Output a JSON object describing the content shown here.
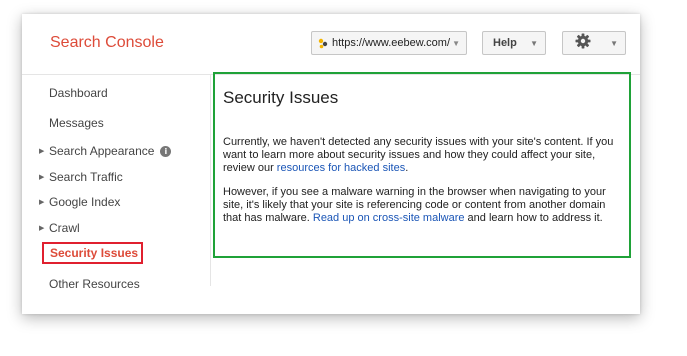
{
  "header": {
    "brand": "Search Console",
    "site_url": "https://www.eebew.com/",
    "help_label": "Help",
    "settings_icon": "gear-icon"
  },
  "sidebar": {
    "items": [
      {
        "label": "Dashboard",
        "expandable": false
      },
      {
        "label": "Messages",
        "expandable": false
      },
      {
        "label": "Search Appearance",
        "expandable": true,
        "info_icon": true
      },
      {
        "label": "Search Traffic",
        "expandable": true
      },
      {
        "label": "Google Index",
        "expandable": true
      },
      {
        "label": "Crawl",
        "expandable": true
      },
      {
        "label": "Security Issues",
        "active": true
      },
      {
        "label": "Other Resources",
        "expandable": false
      }
    ]
  },
  "main": {
    "title": "Security Issues",
    "p1_text_before": "Currently, we haven't detected any security issues with your site's content. If you want to learn more about security issues and how they could affect your site, review our ",
    "p1_link": "resources for hacked sites",
    "p1_text_after": ".",
    "p2_text_before": "However, if you see a malware warning in the browser when navigating to your site, it's likely that your site is referencing code or content from another domain that has malware. ",
    "p2_link": "Read up on cross-site malware",
    "p2_text_after": " and learn how to address it."
  },
  "colors": {
    "brand": "#dd4b39",
    "link": "#1a55b6",
    "active_highlight_border": "#e0202f",
    "content_highlight_border": "#1fa238"
  }
}
